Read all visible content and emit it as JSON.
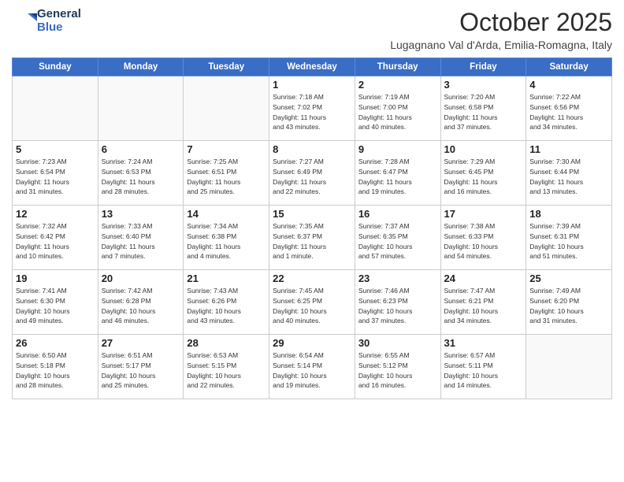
{
  "header": {
    "logo_line1": "General",
    "logo_line2": "Blue",
    "month": "October 2025",
    "location": "Lugagnano Val d'Arda, Emilia-Romagna, Italy"
  },
  "days_of_week": [
    "Sunday",
    "Monday",
    "Tuesday",
    "Wednesday",
    "Thursday",
    "Friday",
    "Saturday"
  ],
  "weeks": [
    [
      {
        "day": "",
        "info": ""
      },
      {
        "day": "",
        "info": ""
      },
      {
        "day": "",
        "info": ""
      },
      {
        "day": "1",
        "info": "Sunrise: 7:18 AM\nSunset: 7:02 PM\nDaylight: 11 hours\nand 43 minutes."
      },
      {
        "day": "2",
        "info": "Sunrise: 7:19 AM\nSunset: 7:00 PM\nDaylight: 11 hours\nand 40 minutes."
      },
      {
        "day": "3",
        "info": "Sunrise: 7:20 AM\nSunset: 6:58 PM\nDaylight: 11 hours\nand 37 minutes."
      },
      {
        "day": "4",
        "info": "Sunrise: 7:22 AM\nSunset: 6:56 PM\nDaylight: 11 hours\nand 34 minutes."
      }
    ],
    [
      {
        "day": "5",
        "info": "Sunrise: 7:23 AM\nSunset: 6:54 PM\nDaylight: 11 hours\nand 31 minutes."
      },
      {
        "day": "6",
        "info": "Sunrise: 7:24 AM\nSunset: 6:53 PM\nDaylight: 11 hours\nand 28 minutes."
      },
      {
        "day": "7",
        "info": "Sunrise: 7:25 AM\nSunset: 6:51 PM\nDaylight: 11 hours\nand 25 minutes."
      },
      {
        "day": "8",
        "info": "Sunrise: 7:27 AM\nSunset: 6:49 PM\nDaylight: 11 hours\nand 22 minutes."
      },
      {
        "day": "9",
        "info": "Sunrise: 7:28 AM\nSunset: 6:47 PM\nDaylight: 11 hours\nand 19 minutes."
      },
      {
        "day": "10",
        "info": "Sunrise: 7:29 AM\nSunset: 6:45 PM\nDaylight: 11 hours\nand 16 minutes."
      },
      {
        "day": "11",
        "info": "Sunrise: 7:30 AM\nSunset: 6:44 PM\nDaylight: 11 hours\nand 13 minutes."
      }
    ],
    [
      {
        "day": "12",
        "info": "Sunrise: 7:32 AM\nSunset: 6:42 PM\nDaylight: 11 hours\nand 10 minutes."
      },
      {
        "day": "13",
        "info": "Sunrise: 7:33 AM\nSunset: 6:40 PM\nDaylight: 11 hours\nand 7 minutes."
      },
      {
        "day": "14",
        "info": "Sunrise: 7:34 AM\nSunset: 6:38 PM\nDaylight: 11 hours\nand 4 minutes."
      },
      {
        "day": "15",
        "info": "Sunrise: 7:35 AM\nSunset: 6:37 PM\nDaylight: 11 hours\nand 1 minute."
      },
      {
        "day": "16",
        "info": "Sunrise: 7:37 AM\nSunset: 6:35 PM\nDaylight: 10 hours\nand 57 minutes."
      },
      {
        "day": "17",
        "info": "Sunrise: 7:38 AM\nSunset: 6:33 PM\nDaylight: 10 hours\nand 54 minutes."
      },
      {
        "day": "18",
        "info": "Sunrise: 7:39 AM\nSunset: 6:31 PM\nDaylight: 10 hours\nand 51 minutes."
      }
    ],
    [
      {
        "day": "19",
        "info": "Sunrise: 7:41 AM\nSunset: 6:30 PM\nDaylight: 10 hours\nand 49 minutes."
      },
      {
        "day": "20",
        "info": "Sunrise: 7:42 AM\nSunset: 6:28 PM\nDaylight: 10 hours\nand 46 minutes."
      },
      {
        "day": "21",
        "info": "Sunrise: 7:43 AM\nSunset: 6:26 PM\nDaylight: 10 hours\nand 43 minutes."
      },
      {
        "day": "22",
        "info": "Sunrise: 7:45 AM\nSunset: 6:25 PM\nDaylight: 10 hours\nand 40 minutes."
      },
      {
        "day": "23",
        "info": "Sunrise: 7:46 AM\nSunset: 6:23 PM\nDaylight: 10 hours\nand 37 minutes."
      },
      {
        "day": "24",
        "info": "Sunrise: 7:47 AM\nSunset: 6:21 PM\nDaylight: 10 hours\nand 34 minutes."
      },
      {
        "day": "25",
        "info": "Sunrise: 7:49 AM\nSunset: 6:20 PM\nDaylight: 10 hours\nand 31 minutes."
      }
    ],
    [
      {
        "day": "26",
        "info": "Sunrise: 6:50 AM\nSunset: 5:18 PM\nDaylight: 10 hours\nand 28 minutes."
      },
      {
        "day": "27",
        "info": "Sunrise: 6:51 AM\nSunset: 5:17 PM\nDaylight: 10 hours\nand 25 minutes."
      },
      {
        "day": "28",
        "info": "Sunrise: 6:53 AM\nSunset: 5:15 PM\nDaylight: 10 hours\nand 22 minutes."
      },
      {
        "day": "29",
        "info": "Sunrise: 6:54 AM\nSunset: 5:14 PM\nDaylight: 10 hours\nand 19 minutes."
      },
      {
        "day": "30",
        "info": "Sunrise: 6:55 AM\nSunset: 5:12 PM\nDaylight: 10 hours\nand 16 minutes."
      },
      {
        "day": "31",
        "info": "Sunrise: 6:57 AM\nSunset: 5:11 PM\nDaylight: 10 hours\nand 14 minutes."
      },
      {
        "day": "",
        "info": ""
      }
    ]
  ]
}
